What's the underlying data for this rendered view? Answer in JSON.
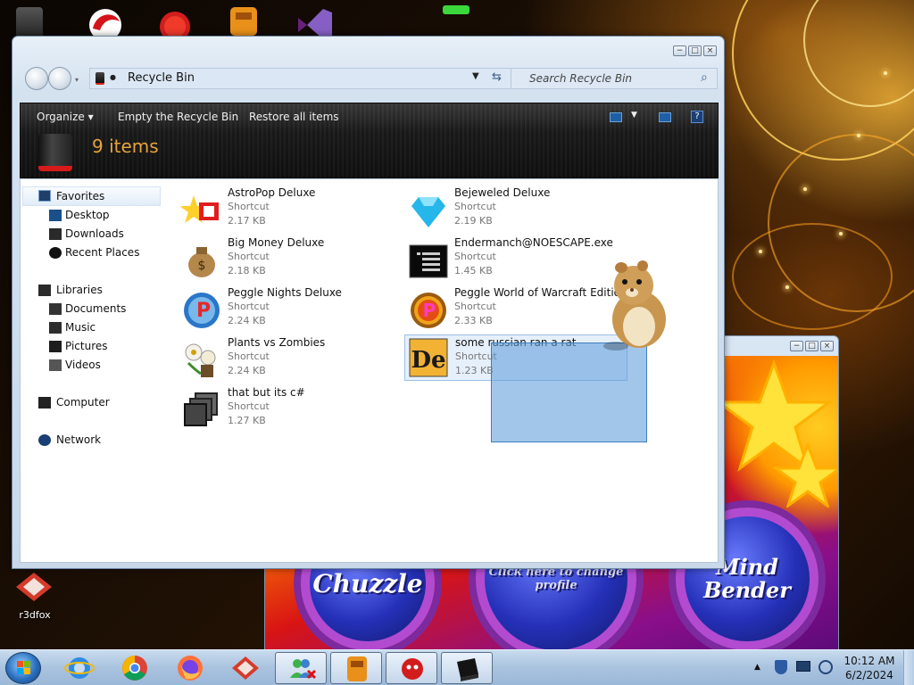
{
  "desktop": {
    "icons": [
      {
        "name": "r3dfox",
        "label": "r3dfox"
      }
    ],
    "colors": {
      "accent": "#ffb030",
      "background": "#1c0f04"
    }
  },
  "explorer": {
    "address": "Recycle Bin",
    "search_placeholder": "Search Recycle Bin",
    "toolbar": {
      "organize": "Organize",
      "empty": "Empty the Recycle Bin",
      "restore": "Restore all items"
    },
    "item_count": "9 items",
    "nav": {
      "favorites": "Favorites",
      "desktop": "Desktop",
      "downloads": "Downloads",
      "recent": "Recent Places",
      "libraries": "Libraries",
      "documents": "Documents",
      "music": "Music",
      "pictures": "Pictures",
      "videos": "Videos",
      "computer": "Computer",
      "network": "Network"
    },
    "files": [
      {
        "name": "AstroPop Deluxe",
        "type": "Shortcut",
        "size": "2.17 KB",
        "icon": "astropop-icon"
      },
      {
        "name": "Big Money Deluxe",
        "type": "Shortcut",
        "size": "2.18 KB",
        "icon": "money-bag-icon"
      },
      {
        "name": "Peggle Nights Deluxe",
        "type": "Shortcut",
        "size": "2.24 KB",
        "icon": "peggle-nights-icon"
      },
      {
        "name": "Plants vs Zombies",
        "type": "Shortcut",
        "size": "2.24 KB",
        "icon": "plants-vs-zombies-icon"
      },
      {
        "name": "that but its c#",
        "type": "Shortcut",
        "size": "1.27 KB",
        "icon": "stacked-windows-icon"
      },
      {
        "name": "Bejeweled Deluxe",
        "type": "Shortcut",
        "size": "2.19 KB",
        "icon": "diamond-icon"
      },
      {
        "name": "Endermanch@NOESCAPE.exe",
        "type": "Shortcut",
        "size": "1.45 KB",
        "icon": "console-icon"
      },
      {
        "name": "Peggle World of Warcraft Edition",
        "type": "Shortcut",
        "size": "2.33 KB",
        "icon": "peggle-wow-icon"
      },
      {
        "name": "some russian ran a rat",
        "type": "Shortcut",
        "size": "1.23 KB",
        "icon": "de-icon"
      }
    ]
  },
  "game_window": {
    "buttons": [
      "Chuzzle",
      "Click here to change profile",
      "Mind Bender"
    ]
  },
  "taskbar": {
    "time": "10:12 AM",
    "date": "6/2/2024"
  }
}
